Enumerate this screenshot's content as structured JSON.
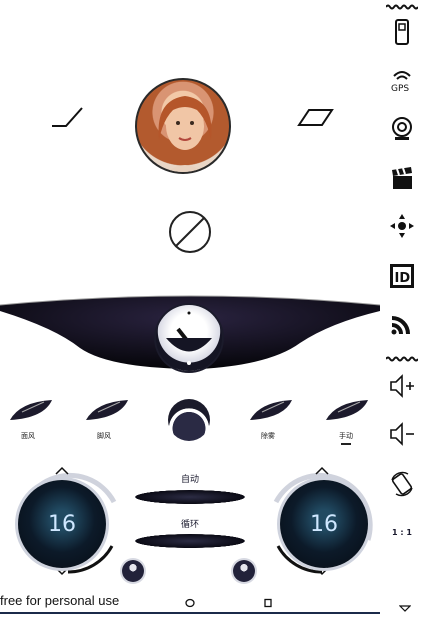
{
  "profile": {
    "avatar_name": "user-avatar"
  },
  "vent_modes": [
    {
      "label": "面风"
    },
    {
      "label": "脚风"
    },
    {
      "label": "除雾"
    },
    {
      "label": "手动"
    }
  ],
  "controls": {
    "auto_label": "自动",
    "recirc_label": "循环"
  },
  "temperatures": {
    "left": "16",
    "right": "16"
  },
  "footer": {
    "text": "free for personal use"
  },
  "sidebar": {
    "items": [
      {
        "icon": "phone-icon"
      },
      {
        "icon": "gps-icon"
      },
      {
        "icon": "camera-icon"
      },
      {
        "icon": "clapper-icon"
      },
      {
        "icon": "direction-pad-icon"
      },
      {
        "icon": "id-icon"
      },
      {
        "icon": "signal-icon"
      },
      {
        "icon": "volume-up-icon"
      },
      {
        "icon": "volume-down-icon"
      },
      {
        "icon": "rotate-icon"
      },
      {
        "icon": "aspect-ratio-icon"
      }
    ],
    "ratio_text": "1 : 1"
  }
}
